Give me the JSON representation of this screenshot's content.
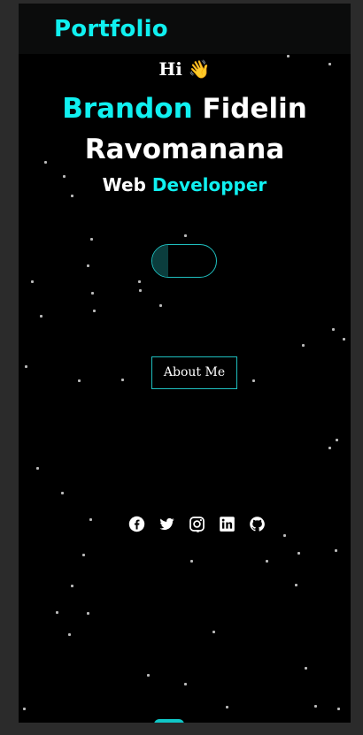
{
  "navbar": {
    "brand": "Portfolio"
  },
  "hero": {
    "greeting": "Hi",
    "wave_emoji": "👋",
    "first_name": "Brandon",
    "last_name_line1": "Fidelin",
    "last_name_line2": "Ravomanana",
    "role_prefix": "Web",
    "role_accent": "Developper"
  },
  "about_button": {
    "label": "About Me"
  },
  "social_icons": [
    "facebook-icon",
    "twitter-icon",
    "instagram-icon",
    "linkedin-icon",
    "github-icon"
  ],
  "colors": {
    "accent": "#10f0f0",
    "background": "#000000",
    "navbar": "#0b0c0c",
    "border": "#1fbfbf"
  }
}
